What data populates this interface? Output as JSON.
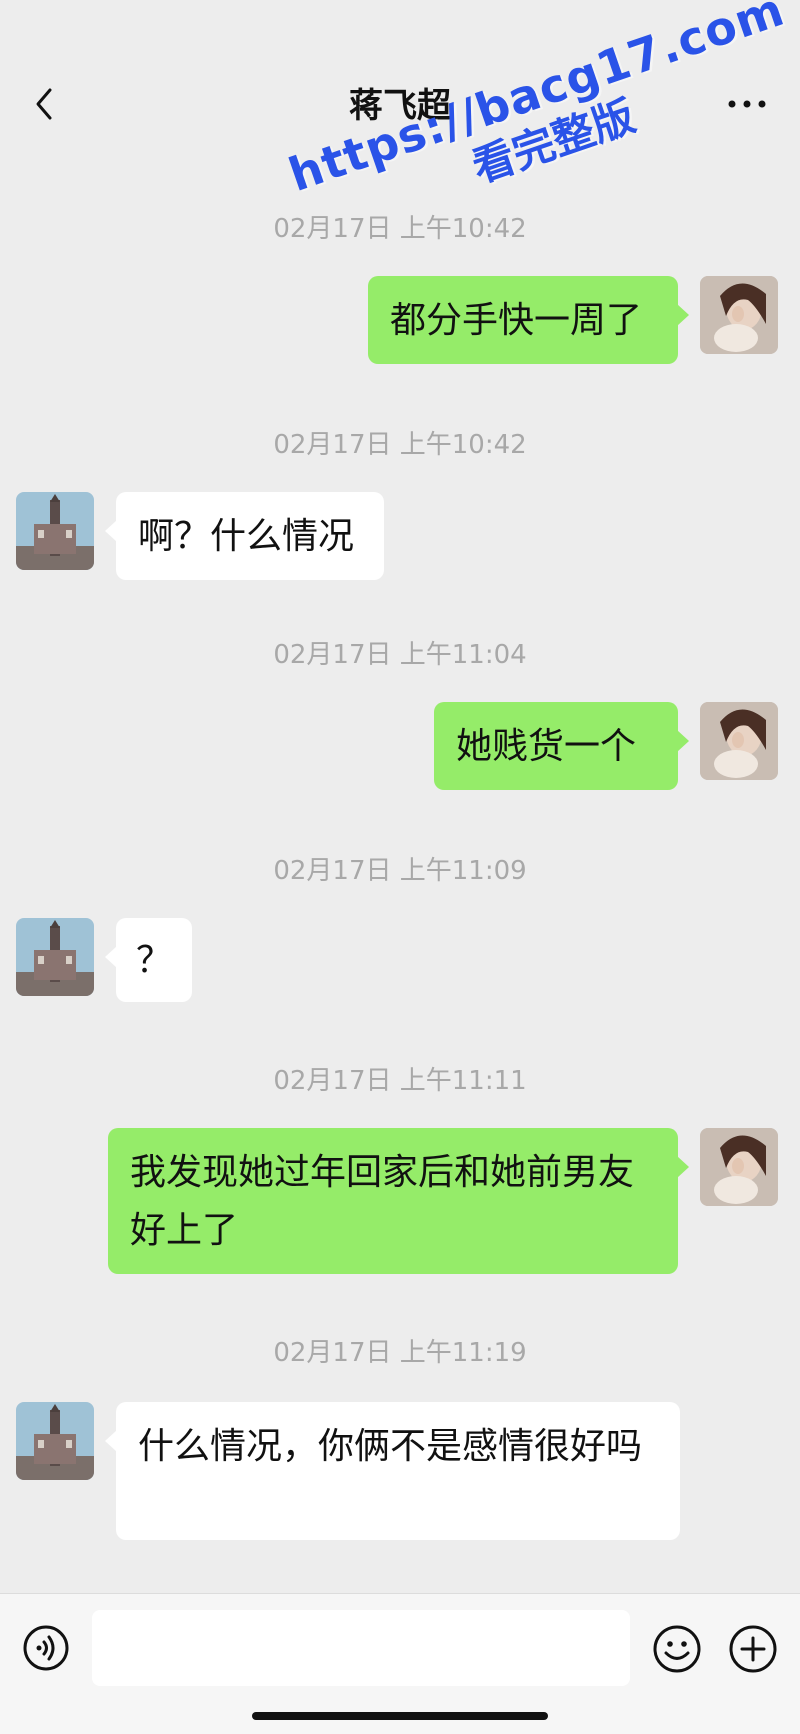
{
  "header": {
    "title": "蒋飞超"
  },
  "watermark": {
    "line1": "https://bacg17.com",
    "line2": "看完整版"
  },
  "messages": [
    {
      "time": "02月17日 上午10:42",
      "from": "me",
      "text": "都分手快一周了"
    },
    {
      "time": "02月17日 上午10:42",
      "from": "contact",
      "text": "啊？什么情况"
    },
    {
      "time": "02月17日 上午11:04",
      "from": "me",
      "text": "她贱货一个"
    },
    {
      "time": "02月17日 上午11:09",
      "from": "contact",
      "text": "？"
    },
    {
      "time": "02月17日 上午11:11",
      "from": "me",
      "text": "我发现她过年回家后和她前男友好上了"
    },
    {
      "time": "02月17日 上午11:19",
      "from": "contact",
      "text": "什么情况，你俩不是感情很好吗"
    }
  ],
  "input": {
    "value": ""
  },
  "icons": {
    "back": "chevron-left-icon",
    "more": "more-dots-icon",
    "voice": "voice-icon",
    "emoji": "emoji-icon",
    "plus": "plus-icon"
  },
  "colors": {
    "outgoing_bubble": "#95ec69",
    "incoming_bubble": "#ffffff",
    "background": "#ededed"
  }
}
